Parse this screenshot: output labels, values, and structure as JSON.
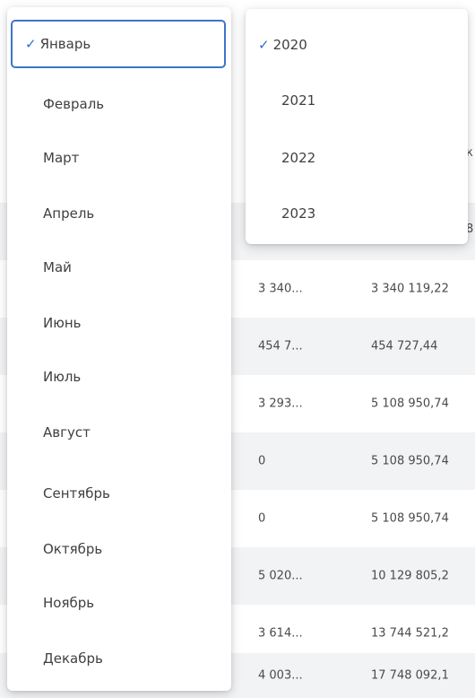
{
  "table": {
    "header_fragment": "к",
    "row0_fragment": "8",
    "rows": [
      {
        "c1": "3 340...",
        "c2": "3 340 119,22"
      },
      {
        "c1": "454 7...",
        "c2": "454 727,44"
      },
      {
        "c1": "3 293...",
        "c2": "5 108 950,74"
      },
      {
        "c1": "0",
        "c2": "5 108 950,74"
      },
      {
        "c1": "0",
        "c2": "5 108 950,74"
      },
      {
        "c1": "5 020...",
        "c2": "10 129 805,2"
      },
      {
        "c1": "3 614...",
        "c2": "13 744 521,2"
      },
      {
        "c1": "4 003...",
        "c2": "17 748 092,1"
      }
    ]
  },
  "month_dropdown": {
    "check": "✓",
    "selected": "Январь",
    "options": [
      "Январь",
      "Февраль",
      "Март",
      "Апрель",
      "Май",
      "Июнь",
      "Июль",
      "Август",
      "Сентябрь",
      "Октябрь",
      "Ноябрь",
      "Декабрь"
    ]
  },
  "year_dropdown": {
    "check": "✓",
    "selected": "2020",
    "options": [
      "2020",
      "2021",
      "2022",
      "2023"
    ]
  },
  "colors": {
    "accent": "#2f6fd0",
    "selected_border": "#3f74c9",
    "row_alt": "#f2f3f5"
  }
}
